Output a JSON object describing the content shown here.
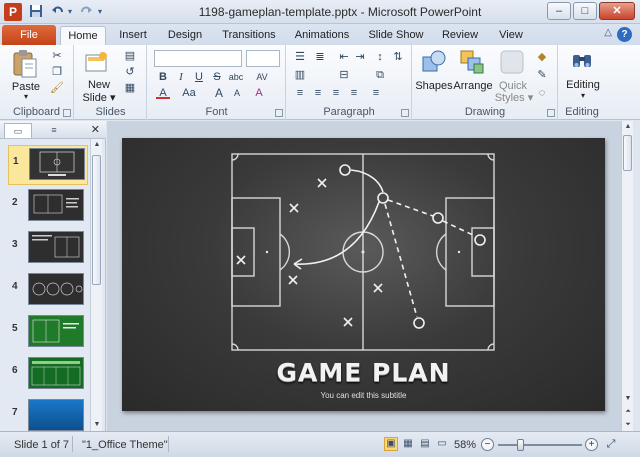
{
  "window": {
    "title": "1198-gameplan-template.pptx - Microsoft PowerPoint",
    "app_letter": "P",
    "buttons": {
      "minimize": "–",
      "maximize": "□",
      "close": "✕"
    }
  },
  "qat": {
    "save": "💾",
    "undo": "↶",
    "redo": "↷",
    "customize": "▾"
  },
  "tabs": {
    "file": "File",
    "items": [
      {
        "label": "Home",
        "active": true
      },
      {
        "label": "Insert"
      },
      {
        "label": "Design"
      },
      {
        "label": "Transitions"
      },
      {
        "label": "Animations"
      },
      {
        "label": "Slide Show"
      },
      {
        "label": "Review"
      },
      {
        "label": "View"
      }
    ],
    "help": "?",
    "collapse": "△"
  },
  "ribbon": {
    "clipboard": {
      "label": "Clipboard",
      "paste": "Paste",
      "paste_arrow": "▾"
    },
    "slides": {
      "label": "Slides",
      "new_slide": "New",
      "new_slide2": "Slide ▾"
    },
    "font": {
      "label": "Font",
      "bold": "B",
      "italic": "I",
      "underline": "U",
      "strike": "S",
      "shadow": "abc",
      "spacing": "AV",
      "color": "A",
      "case": "Aa",
      "grow": "A",
      "shrink": "A",
      "clear": "A"
    },
    "paragraph": {
      "label": "Paragraph"
    },
    "drawing": {
      "label": "Drawing",
      "shapes": "Shapes",
      "arrange": "Arrange",
      "quick_styles": "Quick",
      "quick_styles2": "Styles ▾"
    },
    "editing": {
      "label": "Editing",
      "editing": "Editing"
    }
  },
  "left_pane": {
    "tab_slides": "▭",
    "tab_outline": "≡",
    "close": "✕",
    "thumbnails": [
      {
        "num": "1",
        "selected": true
      },
      {
        "num": "2"
      },
      {
        "num": "3"
      },
      {
        "num": "4"
      },
      {
        "num": "5"
      },
      {
        "num": "6"
      },
      {
        "num": "7"
      }
    ]
  },
  "slide": {
    "title": "GAME PLAN",
    "subtitle": "You can edit this subtitle"
  },
  "status": {
    "slide_info": "Slide 1 of 7",
    "theme": "\"1_Office Theme\"",
    "zoom": "58%",
    "zoom_level": 0.58,
    "zoom_minus": "−",
    "zoom_plus": "+"
  },
  "colors": {
    "file_tab": "#c4431a",
    "selected_thumb": "#fbe79b",
    "slide_bg": "#3a3a3a"
  }
}
